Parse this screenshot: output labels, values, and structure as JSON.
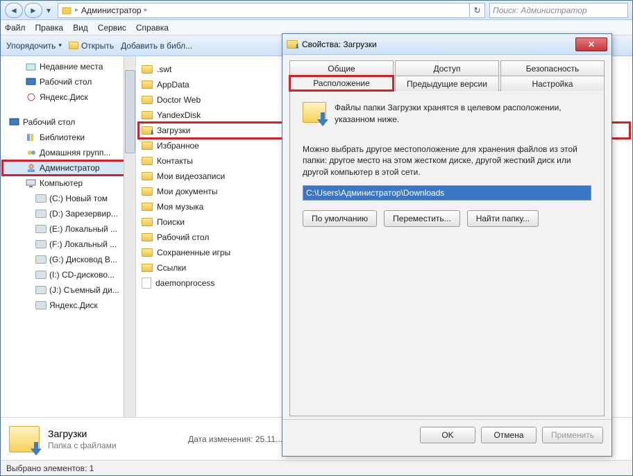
{
  "address": {
    "crumb1": "Администратор"
  },
  "search": {
    "placeholder": "Поиск: Администратор"
  },
  "menu": {
    "file": "Файл",
    "edit": "Правка",
    "view": "Вид",
    "service": "Сервис",
    "help": "Справка"
  },
  "toolbar": {
    "organize": "Упорядочить",
    "open": "Открыть",
    "addlib": "Добавить в библ..."
  },
  "tree": {
    "recent": "Недавние места",
    "desktop_fav": "Рабочий стол",
    "yadisk_fav": "Яндекс.Диск",
    "desktop": "Рабочий стол",
    "libraries": "Библиотеки",
    "homegroup": "Домашняя групп...",
    "user": "Администратор",
    "computer": "Компьютер",
    "drive_c": "(C:) Новый том",
    "drive_d": "(D:) Зарезервир...",
    "drive_e": "(E:) Локальный ...",
    "drive_f": "(F:) Локальный ...",
    "drive_g": "(G:) Дисковод B...",
    "drive_i": "(I:) CD-дисково...",
    "drive_j": "(J:) Съемный ди...",
    "yadisk_net": "Яндекс.Диск"
  },
  "list": [
    ".swt",
    "AppData",
    "Doctor Web",
    "YandexDisk",
    "Загрузки",
    "Избранное",
    "Контакты",
    "Мои видеозаписи",
    "Мои документы",
    "Моя музыка",
    "Поиски",
    "Рабочий стол",
    "Сохраненные игры",
    "Ссылки"
  ],
  "list_file": "daemonprocess",
  "details": {
    "title": "Загрузки",
    "sub": "Папка с файлами",
    "modlabel": "Дата изменения:",
    "modval": "25.11..."
  },
  "status": "Выбрано элементов: 1",
  "props": {
    "title": "Свойства: Загрузки",
    "tabs": {
      "general": "Общие",
      "sharing": "Доступ",
      "security": "Безопасность",
      "location": "Расположение",
      "prev": "Предыдущие версии",
      "custom": "Настройка"
    },
    "desc1": "Файлы папки Загрузки хранятся в целевом расположении, указанном ниже.",
    "desc2": "Можно выбрать другое местоположение для хранения файлов из этой папки: другое место на этом жестком диске, другой жесткий диск или другой компьютер в этой сети.",
    "path": "C:\\Users\\Администратор\\Downloads",
    "btn_default": "По умолчанию",
    "btn_move": "Переместить...",
    "btn_find": "Найти папку...",
    "ok": "OK",
    "cancel": "Отмена",
    "apply": "Применить"
  }
}
